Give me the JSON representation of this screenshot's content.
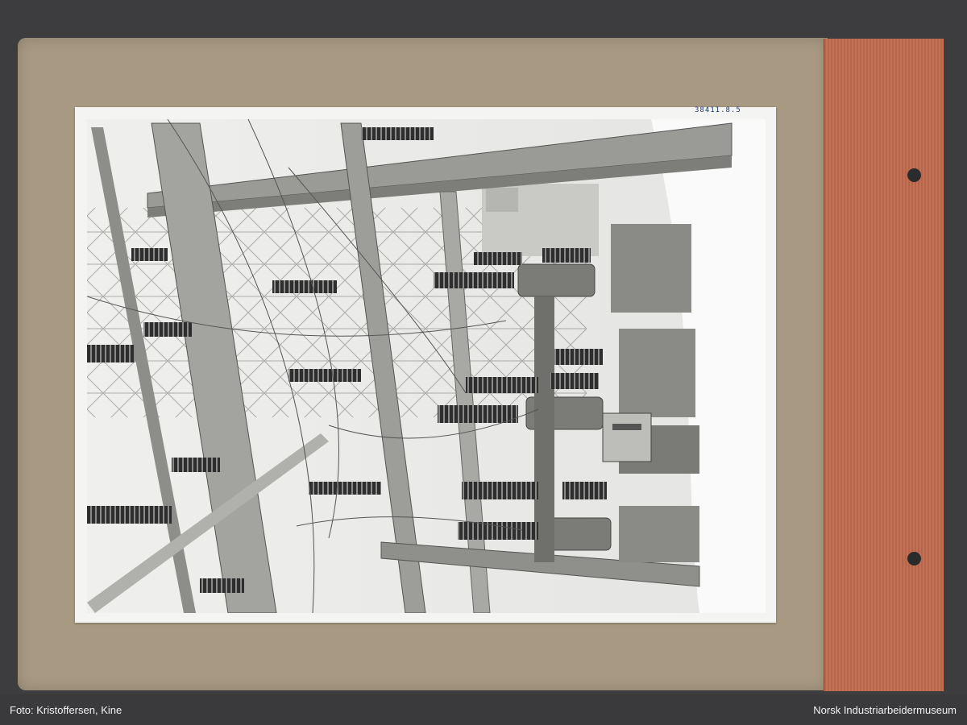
{
  "photo": {
    "pencil_note": "38411.8.5"
  },
  "footer": {
    "photo_credit": "Foto: Kristoffersen, Kine",
    "museum": "Norsk Industriarbeidermuseum"
  }
}
